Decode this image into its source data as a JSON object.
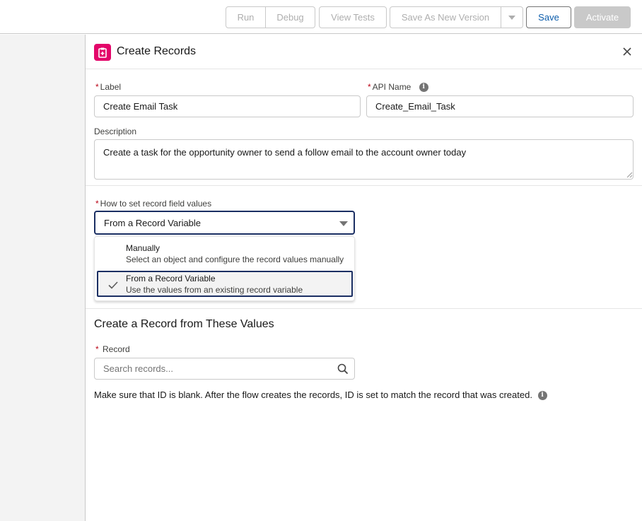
{
  "toolbar": {
    "run": "Run",
    "debug": "Debug",
    "view_tests": "View Tests",
    "save_as_new_version": "Save As New Version",
    "save": "Save",
    "activate": "Activate"
  },
  "panel": {
    "title": "Create Records",
    "icon": "create-record-icon"
  },
  "form": {
    "label_label": "Label",
    "label_value": "Create Email Task",
    "api_name_label": "API Name",
    "api_name_value": "Create_Email_Task",
    "description_label": "Description",
    "description_value": "Create a task for the opportunity owner to send a follow email to the account owner today",
    "how_label": "How to set record field values",
    "how_value": "From a Record Variable",
    "options": [
      {
        "title": "Manually",
        "subtitle": "Select an object and configure the record values manually",
        "selected": false
      },
      {
        "title": "From a Record Variable",
        "subtitle": "Use the values from an existing record variable",
        "selected": true
      }
    ]
  },
  "section": {
    "title": "Create a Record from These Values",
    "record_label": "Record",
    "record_placeholder": "Search records...",
    "help": "Make sure that ID is blank. After the flow creates the records, ID is set to match the record that was created."
  },
  "colors": {
    "brand_pink": "#e3066a",
    "focus_navy": "#1b2f63",
    "required_red": "#ba0517",
    "link_blue": "#0b5cab"
  }
}
